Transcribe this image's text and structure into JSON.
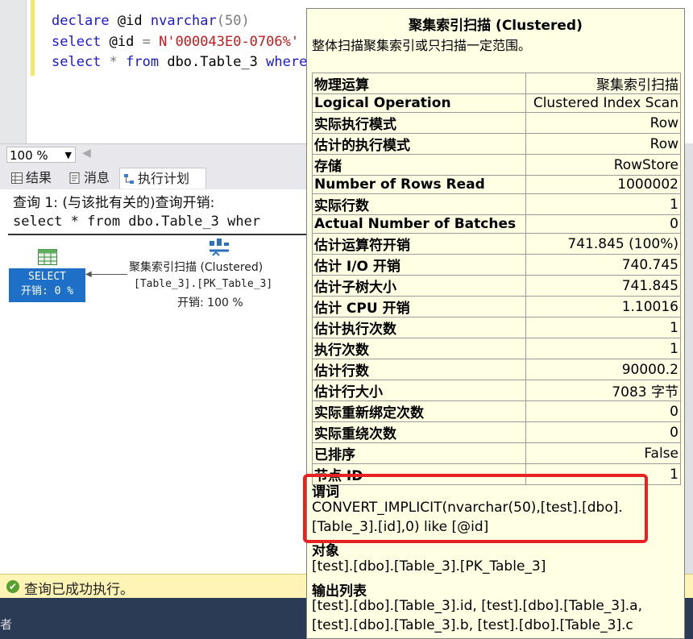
{
  "editor": {
    "lines": [
      {
        "kw1": "declare",
        "rest": " @id ",
        "kw2": "nvarchar",
        "tail": "(50)"
      },
      {
        "kw1": "select",
        "rest": " @id ",
        "op": "=",
        "str": " N'000043E0-0706%'"
      },
      {
        "kw1": "select",
        "star": " * ",
        "kw2": "from",
        "rest": " dbo.Table_3 ",
        "kw3": "where"
      }
    ]
  },
  "zoom": {
    "value": "100 %"
  },
  "tabs": [
    {
      "label": "结果",
      "icon": "grid-icon"
    },
    {
      "label": "消息",
      "icon": "message-icon"
    },
    {
      "label": "执行计划",
      "icon": "plan-icon"
    }
  ],
  "results": {
    "query_header": "查询 1: (与该批有关的)查询开销:",
    "query_sql": "select * from dbo.Table_3 wher",
    "select_node": {
      "title": "SELECT",
      "cost": "开销: 0 %"
    },
    "scan_node": {
      "line1": "聚集索引扫描 (Clustered)",
      "line2": "[Table_3].[PK_Table_3]",
      "line3": "开销: 100 %"
    }
  },
  "status": {
    "text": "查询已成功执行。"
  },
  "bottom_char": "者",
  "tooltip": {
    "title": "聚集索引扫描 (Clustered)",
    "description": "整体扫描聚集索引或只扫描一定范围。",
    "rows": [
      {
        "k": "物理运算",
        "v": "聚集索引扫描"
      },
      {
        "k": "Logical Operation",
        "v": "Clustered Index Scan"
      },
      {
        "k": "实际执行模式",
        "v": "Row"
      },
      {
        "k": "估计的执行模式",
        "v": "Row"
      },
      {
        "k": "存储",
        "v": "RowStore"
      },
      {
        "k": "Number of Rows Read",
        "v": "1000002"
      },
      {
        "k": "实际行数",
        "v": "1"
      },
      {
        "k": "Actual Number of Batches",
        "v": "0"
      },
      {
        "k": "估计运算符开销",
        "v": "741.845 (100%)"
      },
      {
        "k": "估计 I/O 开销",
        "v": "740.745"
      },
      {
        "k": "估计子树大小",
        "v": "741.845"
      },
      {
        "k": "估计 CPU 开销",
        "v": "1.10016"
      },
      {
        "k": "估计执行次数",
        "v": "1"
      },
      {
        "k": "执行次数",
        "v": "1"
      },
      {
        "k": "估计行数",
        "v": "90000.2"
      },
      {
        "k": "估计行大小",
        "v": "7083 字节"
      },
      {
        "k": "实际重新绑定次数",
        "v": "0"
      },
      {
        "k": "实际重绕次数",
        "v": "0"
      },
      {
        "k": "已排序",
        "v": "False"
      },
      {
        "k": "节点 ID",
        "v": "1"
      }
    ],
    "predicate": {
      "label": "谓词",
      "line1": "CONVERT_IMPLICIT(nvarchar(50),[test].[dbo].",
      "line2": "[Table_3].[id],0) like [@id]"
    },
    "object": {
      "label": "对象",
      "value": "[test].[dbo].[Table_3].[PK_Table_3]"
    },
    "output": {
      "label": "输出列表",
      "line1": "[test].[dbo].[Table_3].id, [test].[dbo].[Table_3].a,",
      "line2": "[test].[dbo].[Table_3].b, [test].[dbo].[Table_3].c"
    }
  }
}
